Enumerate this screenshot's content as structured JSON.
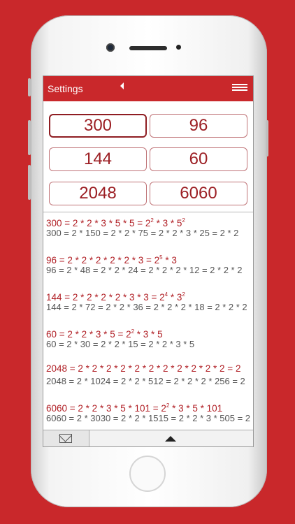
{
  "topbar": {
    "title": "Settings"
  },
  "numbers": [
    "300",
    "96",
    "144",
    "60",
    "2048",
    "6060"
  ],
  "results": [
    {
      "line1": "300 = 2 * 2 * 3 * 5 * 5 = 2",
      "line1_exp": [
        {
          "base_prefix": "",
          "e": "2"
        }
      ],
      "line2": "300 = 2 * 150 = 2 * 2 * 75 = 2 * 2 * 3 * 25 = 2 * 2"
    },
    {
      "line1": "96 = 2 * 2 * 2 * 2 * 2 * 3 = 2",
      "line2": "96 = 2 * 48 = 2 * 2 * 24 = 2 * 2 * 2 * 12 = 2 * 2 * 2"
    },
    {
      "line1": "144 = 2 * 2 * 2 * 2 * 3 * 3 = 2",
      "line2": "144 = 2 * 72 = 2 * 2 * 36 = 2 * 2 * 2 * 18 = 2 * 2 * 2"
    },
    {
      "line1": "60 = 2 * 2 * 3 * 5 = 2",
      "line2": "60 = 2 * 30 = 2 * 2 * 15 = 2 * 2 * 3 * 5"
    },
    {
      "line1": "2048 = 2 * 2 * 2 * 2 * 2 * 2 * 2 * 2 * 2 * 2 * 2 = 2",
      "line2": "2048 = 2 * 1024 = 2 * 2 * 512 = 2 * 2 * 2 * 256 = 2"
    },
    {
      "line1": "6060 = 2 * 2 * 3 * 5 * 101 = 2",
      "line2": "6060 = 2 * 3030 = 2 * 2 * 1515 = 2 * 2 * 3 * 505 = 2"
    }
  ],
  "sup": {
    "r1a": "2",
    "r1b": "2",
    "r2": "5",
    "r3a": "4",
    "r3b": "2",
    "r4": "2",
    "r6": "2"
  },
  "tail": {
    "r1": " * 3 * 5",
    "r2": " * 3",
    "r3": " * 3",
    "r4": " * 3 * 5",
    "r6": " * 3 * 5 * 101"
  },
  "colors": {
    "brand": "#c9282b",
    "text_red": "#b01e24"
  },
  "icons": {
    "menu": "hamburger-icon",
    "back": "back-arrow-icon",
    "mail": "mail-icon",
    "up": "up-arrow-icon"
  }
}
